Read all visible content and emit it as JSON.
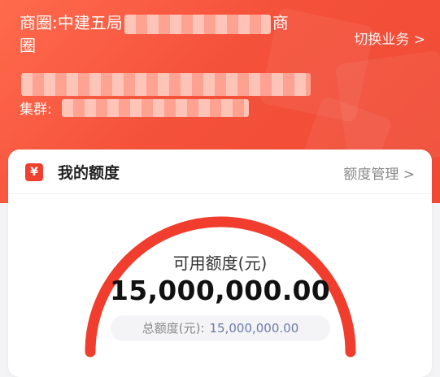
{
  "header": {
    "district_prefix": "商圈:中建五局",
    "district_suffix": "商",
    "district_line2": "圈",
    "switch_label": "切换业务 >",
    "cluster_label": "集群:"
  },
  "card": {
    "icon_glyph": "¥",
    "title": "我的额度",
    "manage_link": "额度管理 >"
  },
  "quota": {
    "available_label": "可用额度(元)",
    "available_value": "15,000,000.00",
    "total_label": "总额度(元):",
    "total_value": "15,000,000.00",
    "gauge_fraction": 1.0
  },
  "colors": {
    "brand_red": "#f04a35",
    "gauge_red": "#f03d2d",
    "total_value_blue": "#6b7ba8"
  }
}
